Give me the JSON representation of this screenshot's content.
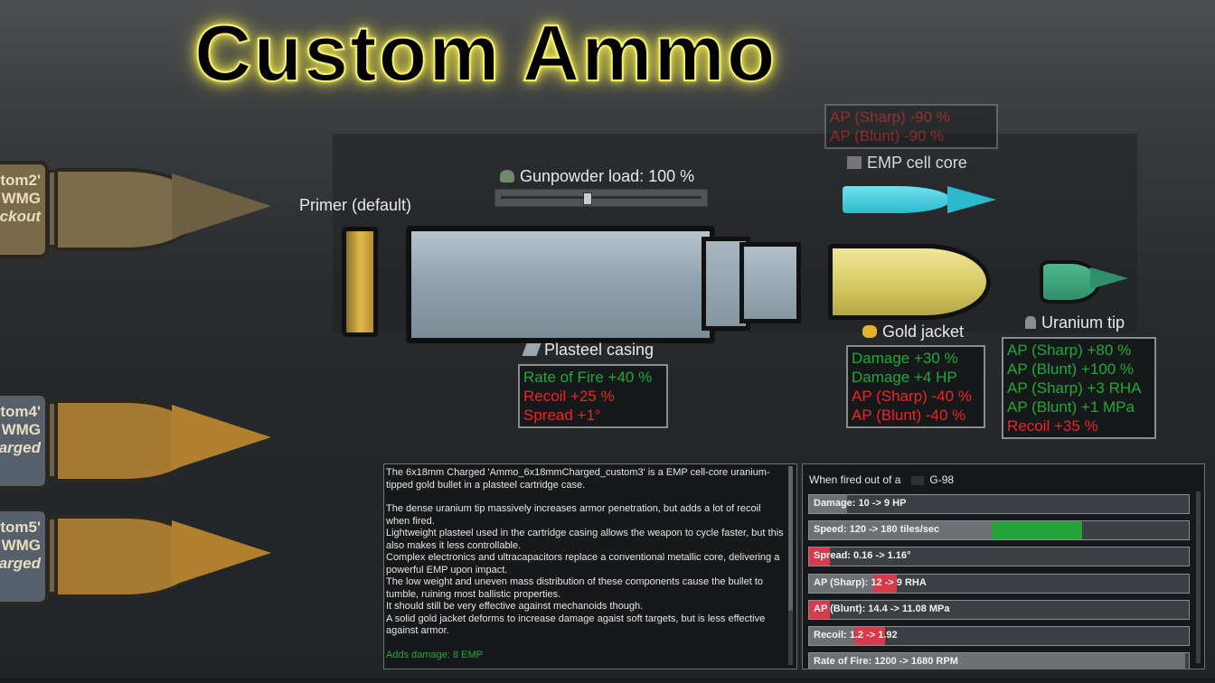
{
  "title": "Custom Ammo",
  "left_bullets": [
    {
      "lines": [
        "tom2'",
        "WMG",
        "ckout"
      ]
    },
    {
      "lines": [
        "tom4'",
        "WMG",
        "arged"
      ]
    },
    {
      "lines": [
        "tom5'",
        "WMG",
        "arged"
      ]
    }
  ],
  "labels": {
    "primer": "Primer (default)",
    "gunpowder": "Gunpowder load: 100 %",
    "emp_core": "EMP cell core",
    "plasteel": "Plasteel casing",
    "gold_jacket": "Gold jacket",
    "uranium_tip": "Uranium tip"
  },
  "gunpowder_level": 0.43,
  "emp_stats": [
    {
      "text": "AP (Sharp) -90 %",
      "tone": "r"
    },
    {
      "text": "AP (Blunt) -90 %",
      "tone": "r"
    }
  ],
  "plasteel_stats": [
    {
      "text": "Rate of Fire +40 %",
      "tone": "g"
    },
    {
      "text": "Recoil +25 %",
      "tone": "r"
    },
    {
      "text": "Spread +1°",
      "tone": "r"
    }
  ],
  "gold_stats": [
    {
      "text": "Damage +30 %",
      "tone": "g"
    },
    {
      "text": "Damage +4 HP",
      "tone": "g"
    },
    {
      "text": "AP (Sharp) -40 %",
      "tone": "r"
    },
    {
      "text": "AP (Blunt) -40 %",
      "tone": "r"
    }
  ],
  "uranium_stats": [
    {
      "text": "AP (Sharp) +80 %",
      "tone": "g"
    },
    {
      "text": "AP (Blunt) +100 %",
      "tone": "g"
    },
    {
      "text": "AP (Sharp) +3 RHA",
      "tone": "g"
    },
    {
      "text": "AP (Blunt) +1 MPa",
      "tone": "g"
    },
    {
      "text": "Recoil +35 %",
      "tone": "r"
    }
  ],
  "description": [
    "The 6x18mm Charged 'Ammo_6x18mmCharged_custom3' is a EMP cell-core uranium-tipped gold bullet in a plasteel cartridge case.",
    "",
    "The dense uranium tip massively increases armor penetration, but adds a lot of recoil when fired.",
    "Lightweight plasteel used in the cartridge casing allows the weapon to cycle faster, but this also makes it less controllable.",
    "Complex electronics and ultracapacitors replace a conventional metallic core, delivering a powerful EMP upon impact.",
    "The low weight and uneven mass distribution of these components cause the bullet to tumble, ruining most ballistic properties.",
    "It should still be very effective against mechanoids though.",
    "A solid gold jacket deforms to increase damage agaist soft targets, but is less effective against armor.",
    ""
  ],
  "description_extra": "Adds damage: 8 EMP",
  "fired": {
    "prefix": "When fired out of a",
    "weapon": "G-98",
    "stats": [
      {
        "label": "Damage: 10 -> 9 HP",
        "base": 0.1,
        "delta": 0,
        "kind": "r"
      },
      {
        "label": "Speed: 120 -> 180 tiles/sec",
        "base": 0.48,
        "delta": 0.24,
        "kind": "g"
      },
      {
        "label": "Spread: 0.16 -> 1.16°",
        "base": 0.0,
        "delta": 0.055,
        "kind": "r"
      },
      {
        "label": "AP (Sharp): 12 -> 9 RHA",
        "base": 0.17,
        "delta": 0.06,
        "kind": "r"
      },
      {
        "label": "AP (Blunt): 14.4 -> 11.08 MPa",
        "base": 0.0,
        "delta": 0.055,
        "kind": "r"
      },
      {
        "label": "Recoil: 1.2 -> 1.92",
        "base": 0.12,
        "delta": 0.08,
        "kind": "r"
      },
      {
        "label": "Rate of Fire: 1200 -> 1680 RPM",
        "base": 0.99,
        "delta": 0,
        "kind": "g"
      }
    ]
  }
}
